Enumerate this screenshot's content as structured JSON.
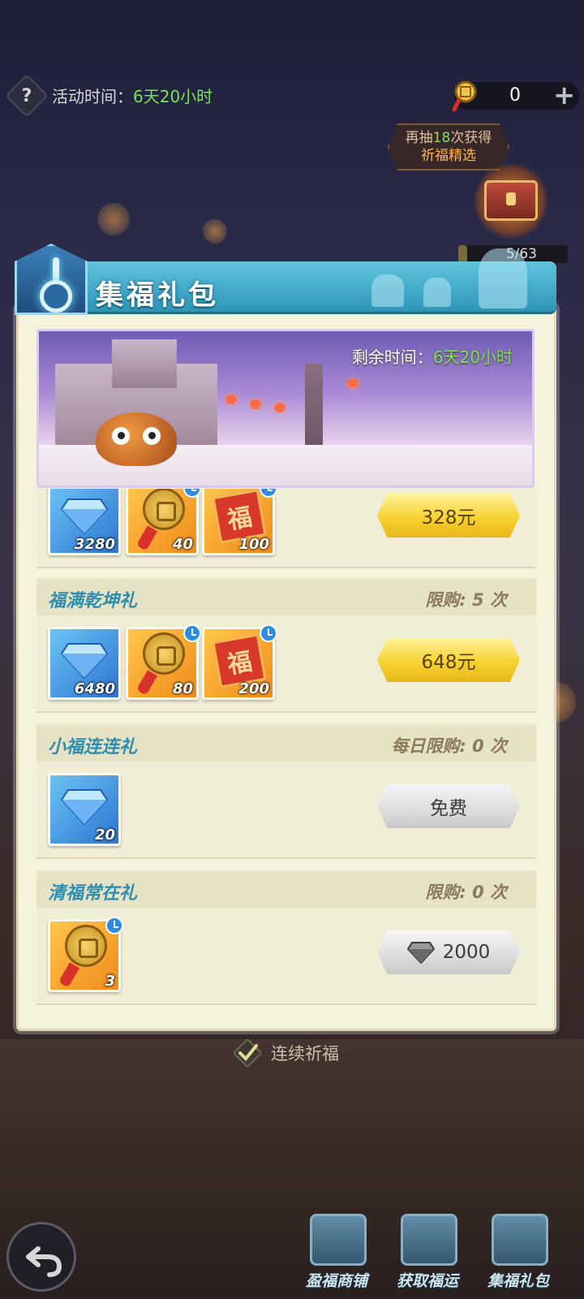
{
  "top_bar": {
    "help_icon": "?",
    "event_time_label": "活动时间：",
    "event_time_value": "6天20小时",
    "coin_count": "0",
    "plus_icon": "+"
  },
  "reminder": {
    "line1_pre": "再抽",
    "line1_count": "18",
    "line1_post": "次获得",
    "line2": "祈福精选"
  },
  "chest_progress": {
    "text": "5/63",
    "fraction": 0.08
  },
  "panel": {
    "title": "集福礼包",
    "banner_time_label": "剩余时间：",
    "banner_time_value": "6天20小时"
  },
  "packs": [
    {
      "name": "",
      "limit": "",
      "items": [
        {
          "type": "diamond",
          "count": "3280",
          "timed": false
        },
        {
          "type": "medal",
          "count": "40",
          "timed": true
        },
        {
          "type": "fu-card",
          "count": "100",
          "timed": true
        }
      ],
      "price": "328元",
      "price_style": "gold"
    },
    {
      "name": "福满乾坤礼",
      "limit": "限购: 5 次",
      "items": [
        {
          "type": "diamond",
          "count": "6480",
          "timed": false
        },
        {
          "type": "medal",
          "count": "80",
          "timed": true
        },
        {
          "type": "fu-card",
          "count": "200",
          "timed": true
        }
      ],
      "price": "648元",
      "price_style": "gold"
    },
    {
      "name": "小福连连礼",
      "limit": "每日限购: 0 次",
      "items": [
        {
          "type": "diamond",
          "count": "20",
          "timed": false
        }
      ],
      "price": "免费",
      "price_style": "gray"
    },
    {
      "name": "清福常在礼",
      "limit": "限购: 0 次",
      "items": [
        {
          "type": "medal",
          "count": "3",
          "timed": true
        }
      ],
      "price": "2000",
      "price_style": "gray",
      "price_icon": "diamond-icon"
    }
  ],
  "fu_char": "福",
  "continue_label": "连续祈福",
  "bottom_nav": [
    {
      "label": "盈福商铺",
      "icon": "shop-icon"
    },
    {
      "label": "获取福运",
      "icon": "fortune-book-icon"
    },
    {
      "label": "集福礼包",
      "icon": "gift-box-icon"
    }
  ],
  "colors": {
    "accent_blue": "#2f8db0",
    "green_time": "#7ee05a",
    "gold_button": "#f6d230"
  }
}
